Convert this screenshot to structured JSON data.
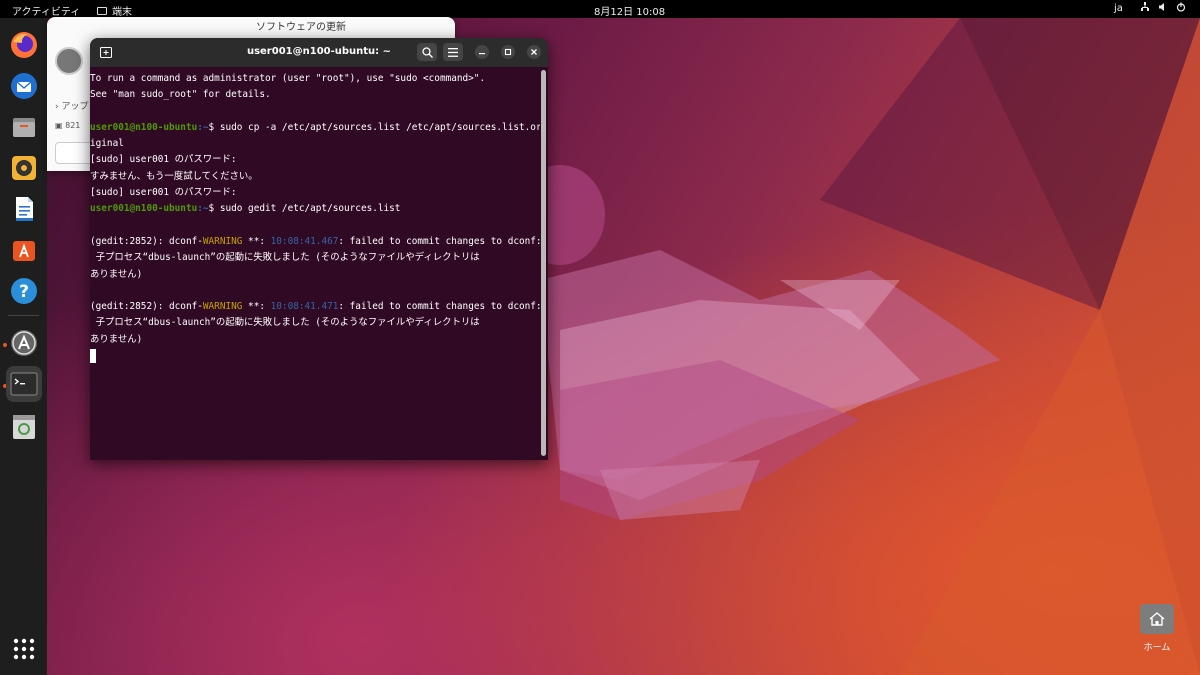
{
  "topbar": {
    "activities": "アクティビティ",
    "app_name": "端末",
    "clock": "8月12日  10:08",
    "lang": "ja"
  },
  "dock": {
    "items": [
      "firefox-icon",
      "thunderbird-icon",
      "files-icon",
      "rhythmbox-icon",
      "libreoffice-writer-icon",
      "app-center-icon",
      "help-icon",
      "software-updater-icon",
      "terminal-icon",
      "trash-icon"
    ],
    "apps_grid": "show-apps-icon"
  },
  "software_window": {
    "title": "ソフトウェアの更新",
    "apps_label": "アップ",
    "row_text": "821"
  },
  "terminal": {
    "title": "user001@n100-ubuntu: ~",
    "lines": {
      "l1": "To run a command as administrator (user \"root\"), use \"sudo <command>\".",
      "l2": "See \"man sudo_root\" for details.",
      "p1_user": "user001@n100-ubuntu",
      "p1_path": ":~",
      "p1_cmd": "$ sudo cp -a /etc/apt/sources.list /etc/apt/sources.list.or",
      "p1_wrap": "iginal",
      "l4": "[sudo] user001 のパスワード:",
      "l5": "すみません、もう一度試してください。",
      "l6": "[sudo] user001 のパスワード:",
      "p2_user": "user001@n100-ubuntu",
      "p2_path": ":~",
      "p2_cmd": "$ sudo gedit /etc/apt/sources.list",
      "w1_pre": "(gedit:2852): dconf-",
      "w1_warn": "WARNING",
      "w1_mid": " **: ",
      "w1_ts": "10:08:41.467",
      "w1_post": ": failed to commit changes to dconf:",
      "w1_l2": " 子プロセス“dbus-launch”の起動に失敗しました (そのようなファイルやディレクトリは",
      "w1_l3": "ありません)",
      "w2_pre": "(gedit:2852): dconf-",
      "w2_warn": "WARNING",
      "w2_mid": " **: ",
      "w2_ts": "10:08:41.471",
      "w2_post": ": failed to commit changes to dconf:",
      "w2_l2": " 子プロセス“dbus-launch”の起動に失敗しました (そのようなファイルやディレクトリは",
      "w2_l3": "ありません)"
    }
  },
  "desktop": {
    "home_label": "ホーム"
  },
  "colors": {
    "terminal_bg": "#300a24",
    "prompt_green": "#4e9a06",
    "path_blue": "#3465a4",
    "warning_yellow": "#c4a000",
    "ubuntu_orange": "#e95420"
  }
}
